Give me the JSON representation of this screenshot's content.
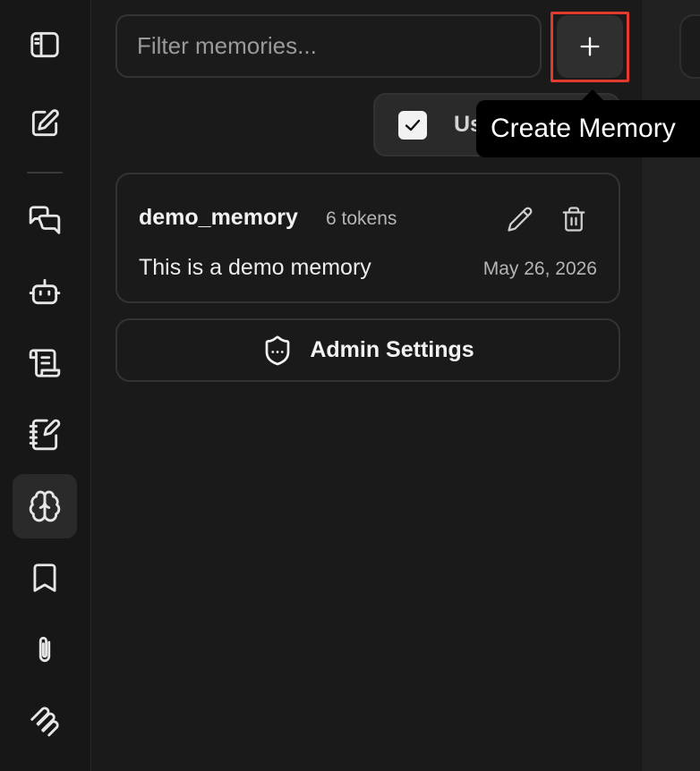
{
  "sidebar": {
    "items": [
      {
        "name": "toggle-sidebar",
        "icon": "sidebar-panel-icon",
        "active": false
      },
      {
        "name": "new-chat",
        "icon": "edit-square-icon",
        "active": false
      },
      {
        "name": "chats",
        "icon": "chat-bubbles-icon",
        "active": false
      },
      {
        "name": "agents",
        "icon": "robot-icon",
        "active": false
      },
      {
        "name": "prompts",
        "icon": "scroll-icon",
        "active": false
      },
      {
        "name": "notes",
        "icon": "notebook-pen-icon",
        "active": false
      },
      {
        "name": "memories",
        "icon": "brain-icon",
        "active": true
      },
      {
        "name": "bookmarks",
        "icon": "bookmark-icon",
        "active": false
      },
      {
        "name": "attachments",
        "icon": "paperclip-icon",
        "active": false
      },
      {
        "name": "mcp",
        "icon": "mcp-icon",
        "active": false
      }
    ]
  },
  "memories": {
    "filter_placeholder": "Filter memories...",
    "filter_value": "",
    "add_icon": "plus-icon",
    "use_memory": {
      "checked": true,
      "label": "Us"
    },
    "tooltip": "Create Memory",
    "items": [
      {
        "key": "demo_memory",
        "tokens": "6 tokens",
        "content": "This is a demo memory",
        "date": "May 26, 2026"
      }
    ],
    "admin_settings_label": "Admin Settings",
    "admin_icon": "shield-icon"
  },
  "colors": {
    "background": "#171717",
    "panel": "#1a1a1a",
    "highlight": "#e23b2e"
  }
}
